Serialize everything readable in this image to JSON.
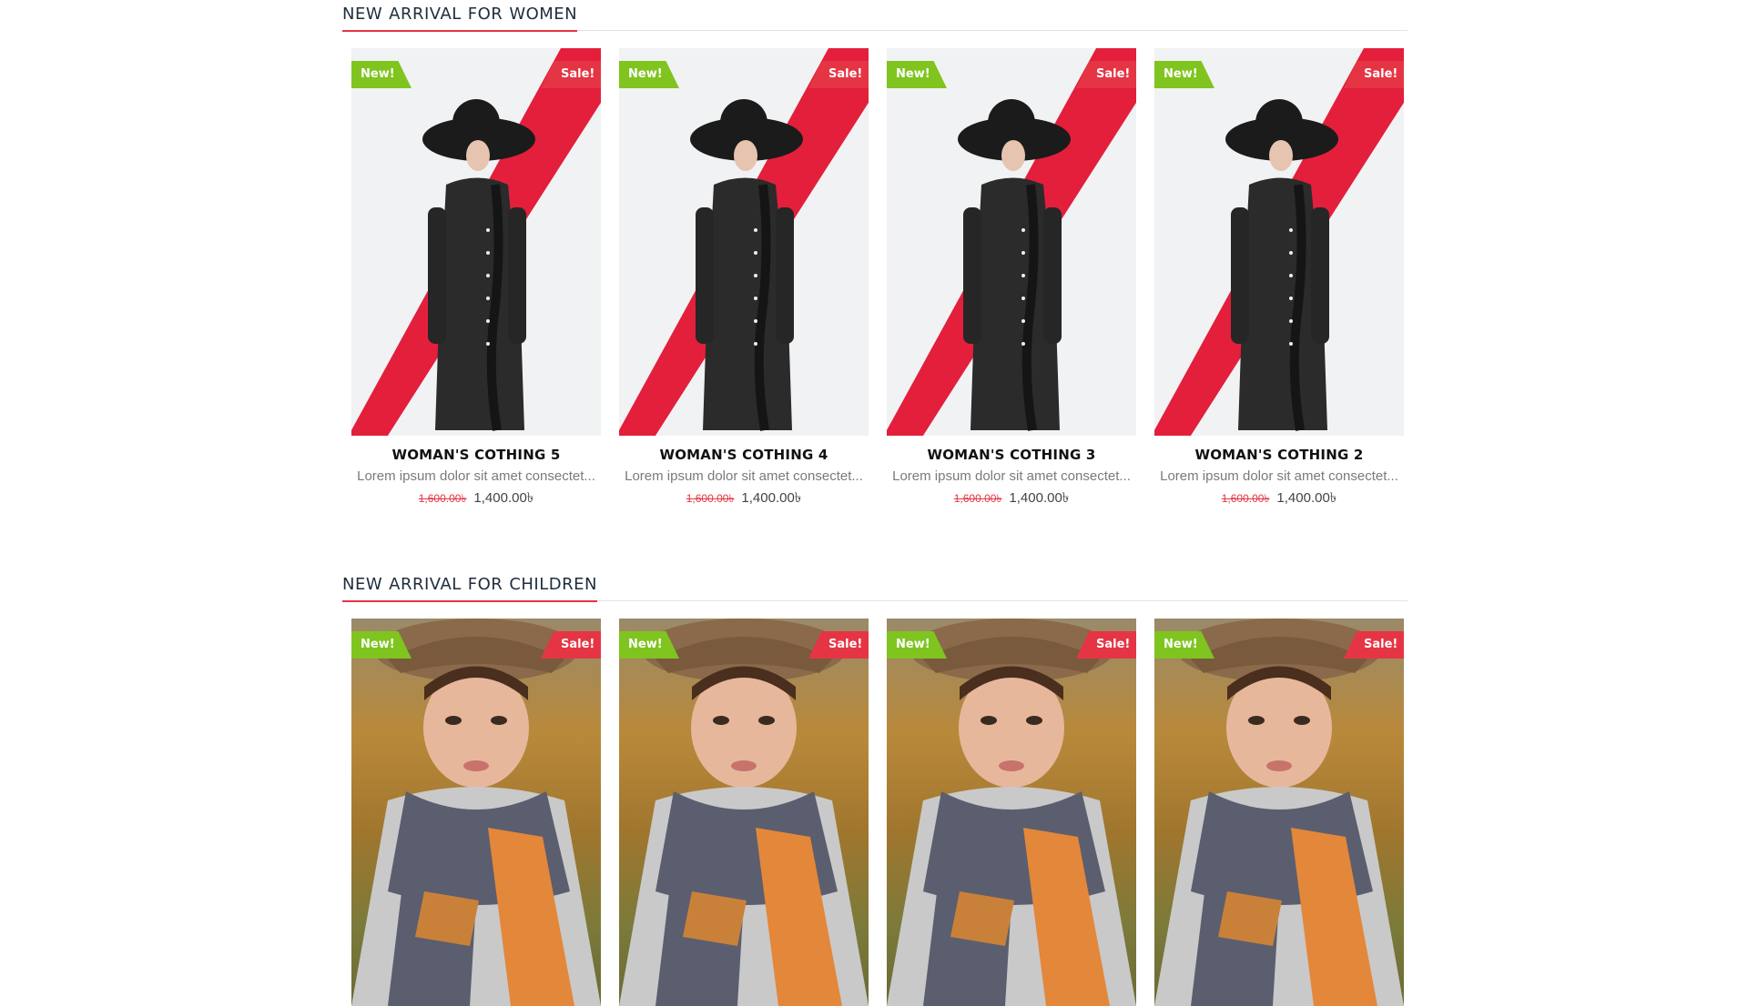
{
  "sections": {
    "women": {
      "title_words": [
        "NEW",
        "ARRIVAL",
        "FOR",
        "WOMEN"
      ],
      "products": [
        {
          "name": "WOMAN'S COTHING 5",
          "desc": "Lorem ipsum dolor sit amet consectet...",
          "old_price": "1,600.00৳",
          "price": "1,400.00৳",
          "badge_new": "New!",
          "badge_sale": "Sale!"
        },
        {
          "name": "WOMAN'S COTHING 4",
          "desc": "Lorem ipsum dolor sit amet consectet...",
          "old_price": "1,600.00৳",
          "price": "1,400.00৳",
          "badge_new": "New!",
          "badge_sale": "Sale!"
        },
        {
          "name": "WOMAN'S COTHING 3",
          "desc": "Lorem ipsum dolor sit amet consectet...",
          "old_price": "1,600.00৳",
          "price": "1,400.00৳",
          "badge_new": "New!",
          "badge_sale": "Sale!"
        },
        {
          "name": "WOMAN'S COTHING 2",
          "desc": "Lorem ipsum dolor sit amet consectet...",
          "old_price": "1,600.00৳",
          "price": "1,400.00৳",
          "badge_new": "New!",
          "badge_sale": "Sale!"
        }
      ]
    },
    "children": {
      "title_words": [
        "NEW",
        "ARRIVAL",
        "FOR",
        "CHILDREN"
      ],
      "products": [
        {
          "badge_new": "New!",
          "badge_sale": "Sale!"
        },
        {
          "badge_new": "New!",
          "badge_sale": "Sale!"
        },
        {
          "badge_new": "New!",
          "badge_sale": "Sale!"
        },
        {
          "badge_new": "New!",
          "badge_sale": "Sale!"
        }
      ]
    }
  },
  "colors": {
    "accent_red": "#e53544",
    "badge_green": "#7fc41f",
    "heading": "#1f2d3d"
  }
}
